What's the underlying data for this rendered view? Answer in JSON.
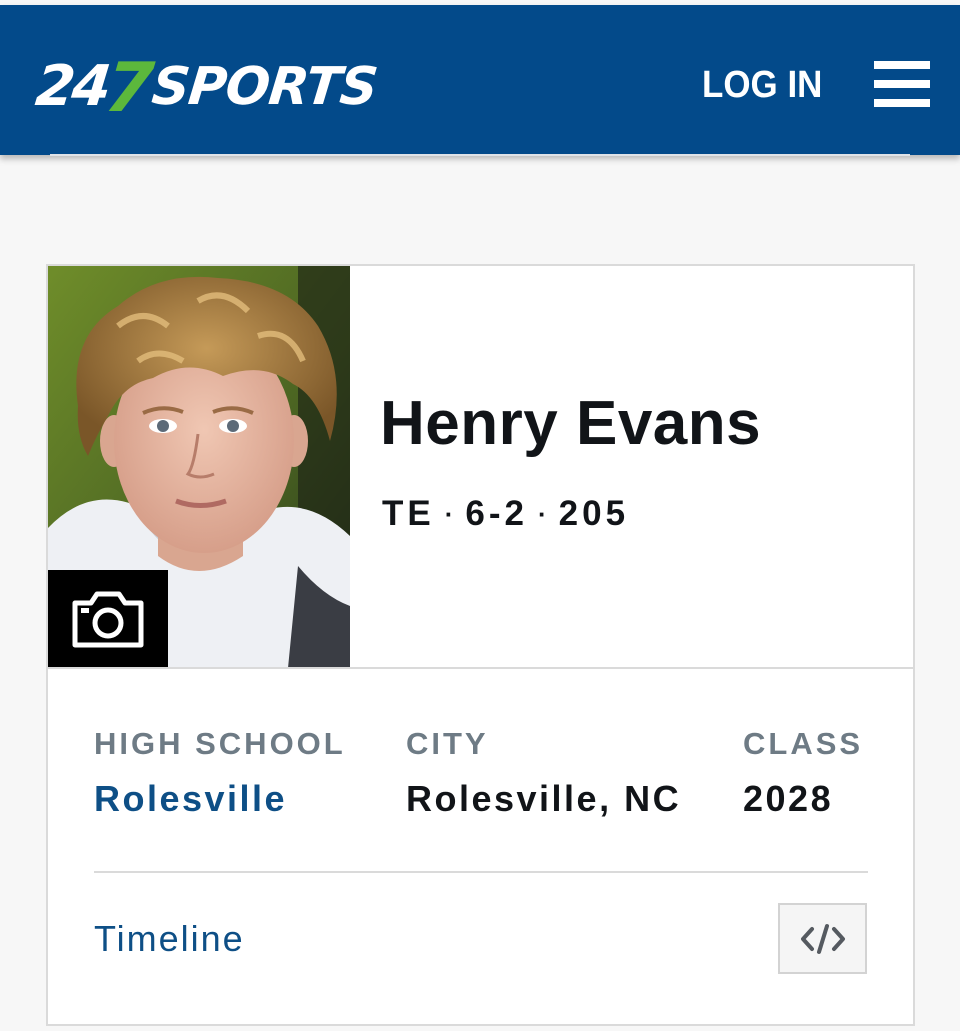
{
  "header": {
    "logo": {
      "part1": "24",
      "part2": "7",
      "part3": "SPORTS",
      "brand_blue": "#034a8a",
      "brand_green": "#5cb83c"
    },
    "login_label": "LOG IN",
    "menu_icon": "hamburger-menu-icon"
  },
  "player": {
    "photo_icon": "camera-icon",
    "name": "Henry Evans",
    "position": "TE",
    "height": "6-2",
    "weight": "205",
    "separator": "·"
  },
  "info": {
    "high_school": {
      "label": "HIGH SCHOOL",
      "value": "Rolesville"
    },
    "city": {
      "label": "CITY",
      "value": "Rolesville, NC"
    },
    "class": {
      "label": "CLASS",
      "value": "2028"
    }
  },
  "footer": {
    "timeline_label": "Timeline",
    "embed_icon": "code-embed-icon"
  },
  "colors": {
    "header_bg": "#034a8a",
    "link": "#0e4f86",
    "label": "#6e7b85",
    "text": "#111418"
  }
}
